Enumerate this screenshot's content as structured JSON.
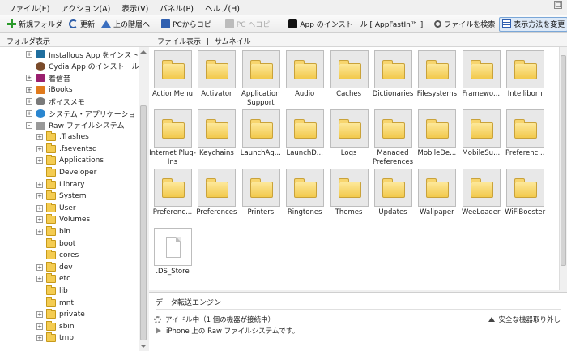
{
  "menu": [
    "ファイル(E)",
    "アクション(A)",
    "表示(V)",
    "パネル(P)",
    "ヘルプ(H)"
  ],
  "toolbar": {
    "new_folder": "新規フォルダ",
    "refresh": "更新",
    "up": "上の階層へ",
    "copy_from_pc": "PCからコピー",
    "copy_to_pc": "PC へコピー",
    "install_app": "App のインストール [ AppFastIn™ ]",
    "search": "ファイルを検索",
    "view_mode": "表示方法を変更"
  },
  "subheader": {
    "folder_view": "フォルダ表示",
    "file_view": "ファイル表示",
    "separator": "|",
    "thumbnail": "サムネイル"
  },
  "tree": [
    {
      "label": "Installous App をインスト",
      "icon": "app-icon",
      "indent": 0,
      "expander": "+"
    },
    {
      "label": "Cydia App のインストール",
      "icon": "cydia-icon",
      "indent": 0,
      "expander": ""
    },
    {
      "label": "着信音",
      "icon": "music-icon",
      "indent": 0,
      "expander": "+"
    },
    {
      "label": "iBooks",
      "icon": "books-icon",
      "indent": 0,
      "expander": "+"
    },
    {
      "label": "ボイスメモ",
      "icon": "voice-memo-icon",
      "indent": 0,
      "expander": "+"
    },
    {
      "label": "システム・アプリケーショ",
      "icon": "system-icon",
      "indent": 0,
      "expander": "+"
    },
    {
      "label": "Raw ファイルシステム",
      "icon": "raw-fs-icon",
      "indent": 0,
      "expander": "-"
    },
    {
      "label": ".Trashes",
      "icon": "folder-icon",
      "indent": 1,
      "expander": "+"
    },
    {
      "label": ".fseventsd",
      "icon": "folder-icon",
      "indent": 1,
      "expander": "+"
    },
    {
      "label": "Applications",
      "icon": "folder-icon",
      "indent": 1,
      "expander": "+"
    },
    {
      "label": "Developer",
      "icon": "folder-icon",
      "indent": 1,
      "expander": ""
    },
    {
      "label": "Library",
      "icon": "folder-icon",
      "indent": 1,
      "expander": "+"
    },
    {
      "label": "System",
      "icon": "folder-icon",
      "indent": 1,
      "expander": "+"
    },
    {
      "label": "User",
      "icon": "folder-icon",
      "indent": 1,
      "expander": "+"
    },
    {
      "label": "Volumes",
      "icon": "folder-icon",
      "indent": 1,
      "expander": "+"
    },
    {
      "label": "bin",
      "icon": "folder-icon",
      "indent": 1,
      "expander": "+"
    },
    {
      "label": "boot",
      "icon": "folder-icon",
      "indent": 1,
      "expander": ""
    },
    {
      "label": "cores",
      "icon": "folder-icon",
      "indent": 1,
      "expander": ""
    },
    {
      "label": "dev",
      "icon": "folder-icon",
      "indent": 1,
      "expander": "+"
    },
    {
      "label": "etc",
      "icon": "folder-icon",
      "indent": 1,
      "expander": "+"
    },
    {
      "label": "lib",
      "icon": "folder-icon",
      "indent": 1,
      "expander": ""
    },
    {
      "label": "mnt",
      "icon": "folder-icon",
      "indent": 1,
      "expander": ""
    },
    {
      "label": "private",
      "icon": "folder-icon",
      "indent": 1,
      "expander": "+"
    },
    {
      "label": "sbin",
      "icon": "folder-icon",
      "indent": 1,
      "expander": "+"
    },
    {
      "label": "tmp",
      "icon": "folder-icon",
      "indent": 1,
      "expander": "+"
    }
  ],
  "files": [
    {
      "label": "ActionMenu",
      "type": "folder"
    },
    {
      "label": "Activator",
      "type": "folder"
    },
    {
      "label": "Application Support",
      "type": "folder"
    },
    {
      "label": "Audio",
      "type": "folder"
    },
    {
      "label": "Caches",
      "type": "folder"
    },
    {
      "label": "Dictionaries",
      "type": "folder"
    },
    {
      "label": "Filesystems",
      "type": "folder"
    },
    {
      "label": "Framewo...",
      "type": "folder"
    },
    {
      "label": "Intelliborn",
      "type": "folder"
    },
    {
      "label": "Internet Plug-Ins",
      "type": "folder"
    },
    {
      "label": "Keychains",
      "type": "folder"
    },
    {
      "label": "LaunchAg...",
      "type": "folder"
    },
    {
      "label": "LaunchD...",
      "type": "folder"
    },
    {
      "label": "Logs",
      "type": "folder"
    },
    {
      "label": "Managed Preferences",
      "type": "folder"
    },
    {
      "label": "MobileDe...",
      "type": "folder"
    },
    {
      "label": "MobileSu...",
      "type": "folder"
    },
    {
      "label": "Preferenc...",
      "type": "folder"
    },
    {
      "label": "Preferenc...",
      "type": "folder"
    },
    {
      "label": "Preferences",
      "type": "folder"
    },
    {
      "label": "Printers",
      "type": "folder"
    },
    {
      "label": "Ringtones",
      "type": "folder"
    },
    {
      "label": "Themes",
      "type": "folder"
    },
    {
      "label": "Updates",
      "type": "folder"
    },
    {
      "label": "Wallpaper",
      "type": "folder"
    },
    {
      "label": "WeeLoader",
      "type": "folder"
    },
    {
      "label": "WiFiBooster",
      "type": "folder"
    },
    {
      "label": ".DS_Store",
      "type": "file"
    }
  ],
  "engine": {
    "title": "データ転送エンジン",
    "status": "アイドル中（1 個の機器が接続中）",
    "path": "iPhone 上の Raw ファイルシステムです。",
    "eject": "安全な機器取り外し"
  },
  "colors": {
    "folder": "#f2c94c",
    "accent": "#2f5fb0",
    "active_border": "#7aa7d8"
  }
}
